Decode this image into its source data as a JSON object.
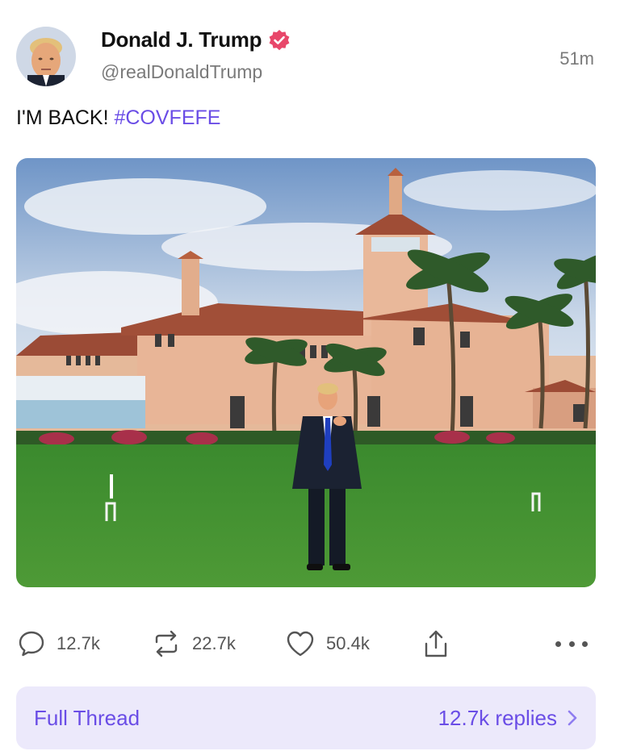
{
  "post": {
    "author_name": "Donald J. Trump",
    "handle": "@realDonaldTrump",
    "time": "51m",
    "text_main": "I'M BACK!",
    "hashtag": "#COVFEFE"
  },
  "actions": {
    "replies": "12.7k",
    "reposts": "22.7k",
    "likes": "50.4k"
  },
  "thread": {
    "label": "Full Thread",
    "replies": "12.7k replies"
  },
  "colors": {
    "accent": "#6a4de6",
    "verified": "#e8476a",
    "thread_bg": "#ece9fb"
  },
  "icons": [
    "verified-badge-icon",
    "reply-icon",
    "repost-icon",
    "like-icon",
    "share-icon",
    "more-icon",
    "chevron-right-icon"
  ]
}
